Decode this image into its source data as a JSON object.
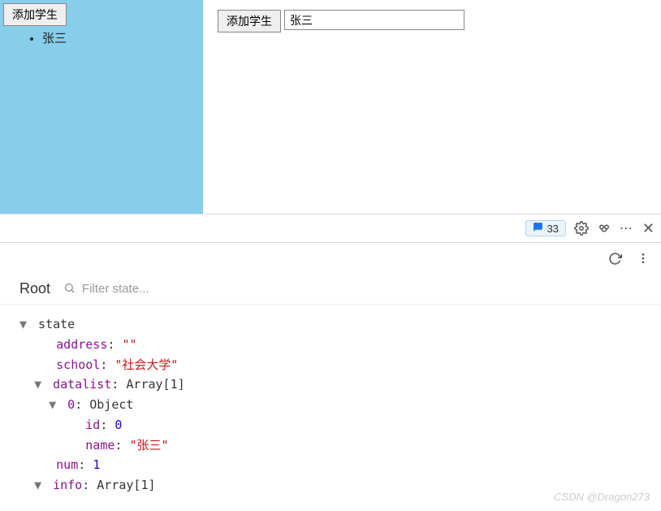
{
  "leftPanel": {
    "buttonLabel": "添加学生",
    "listItems": [
      "张三"
    ]
  },
  "rightPanel": {
    "buttonLabel": "添加学生",
    "inputValue": "张三"
  },
  "devtoolsBar": {
    "badgeCount": "33"
  },
  "filterBar": {
    "rootLabel": "Root",
    "placeholder": "Filter state..."
  },
  "tree": {
    "stateLabel": "state",
    "address": {
      "key": "address",
      "value": "\"\""
    },
    "school": {
      "key": "school",
      "value": "\"社会大学\""
    },
    "datalist": {
      "key": "datalist",
      "type": "Array[1]"
    },
    "item0": {
      "key": "0",
      "type": "Object"
    },
    "id": {
      "key": "id",
      "value": "0"
    },
    "name": {
      "key": "name",
      "value": "\"张三\""
    },
    "num": {
      "key": "num",
      "value": "1"
    },
    "info": {
      "key": "info",
      "type": "Array[1]"
    }
  },
  "watermark": "CSDN @Dragon273"
}
